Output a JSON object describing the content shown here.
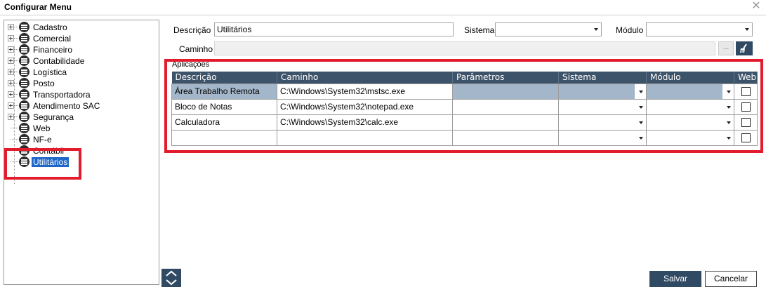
{
  "window": {
    "title": "Configurar Menu",
    "close_icon": "close-icon"
  },
  "tree": {
    "items": [
      {
        "label": "Cadastro",
        "expandable": true
      },
      {
        "label": "Comercial",
        "expandable": true
      },
      {
        "label": "Financeiro",
        "expandable": true
      },
      {
        "label": "Contabilidade",
        "expandable": true
      },
      {
        "label": "Logística",
        "expandable": true
      },
      {
        "label": "Posto",
        "expandable": true
      },
      {
        "label": "Transportadora",
        "expandable": true
      },
      {
        "label": "Atendimento SAC",
        "expandable": true
      },
      {
        "label": "Segurança",
        "expandable": true
      },
      {
        "label": "Web",
        "expandable": false
      },
      {
        "label": "NF-e",
        "expandable": false
      },
      {
        "label": "Contábil",
        "expandable": false
      },
      {
        "label": "Utilitários",
        "expandable": false,
        "selected": true
      }
    ]
  },
  "form": {
    "descricao_label": "Descrição",
    "descricao_value": "Utilitários",
    "sistema_label": "Sistema",
    "sistema_value": "",
    "modulo_label": "Módulo",
    "modulo_value": "",
    "caminho_label": "Caminho",
    "caminho_value": "",
    "browse_label": "...",
    "clear_icon": "broom-icon"
  },
  "applications": {
    "group_title": "Aplicações",
    "columns": [
      "Descrição",
      "Caminho",
      "Parâmetros",
      "Sistema",
      "Módulo",
      "Web"
    ],
    "rows": [
      {
        "descricao": "Área Trabalho Remota",
        "caminho": "C:\\Windows\\System32\\mstsc.exe",
        "parametros": "",
        "sistema": "",
        "modulo": "",
        "web": false
      },
      {
        "descricao": "Bloco de Notas",
        "caminho": "C:\\Windows\\System32\\notepad.exe",
        "parametros": "",
        "sistema": "",
        "modulo": "",
        "web": false
      },
      {
        "descricao": "Calculadora",
        "caminho": "C:\\Windows\\System32\\calc.exe",
        "parametros": "",
        "sistema": "",
        "modulo": "",
        "web": false
      },
      {
        "descricao": "",
        "caminho": "",
        "parametros": "",
        "sistema": "",
        "modulo": "",
        "web": false
      }
    ]
  },
  "footer": {
    "save_label": "Salvar",
    "cancel_label": "Cancelar",
    "move_up_icon": "chevron-up-icon",
    "move_down_icon": "chevron-down-icon"
  },
  "colors": {
    "highlight_red": "#e21c2c",
    "header_navy": "#3d5369",
    "button_navy": "#304a63",
    "selected_row": "#a4b6c9",
    "tree_selected": "#1e66c8"
  }
}
